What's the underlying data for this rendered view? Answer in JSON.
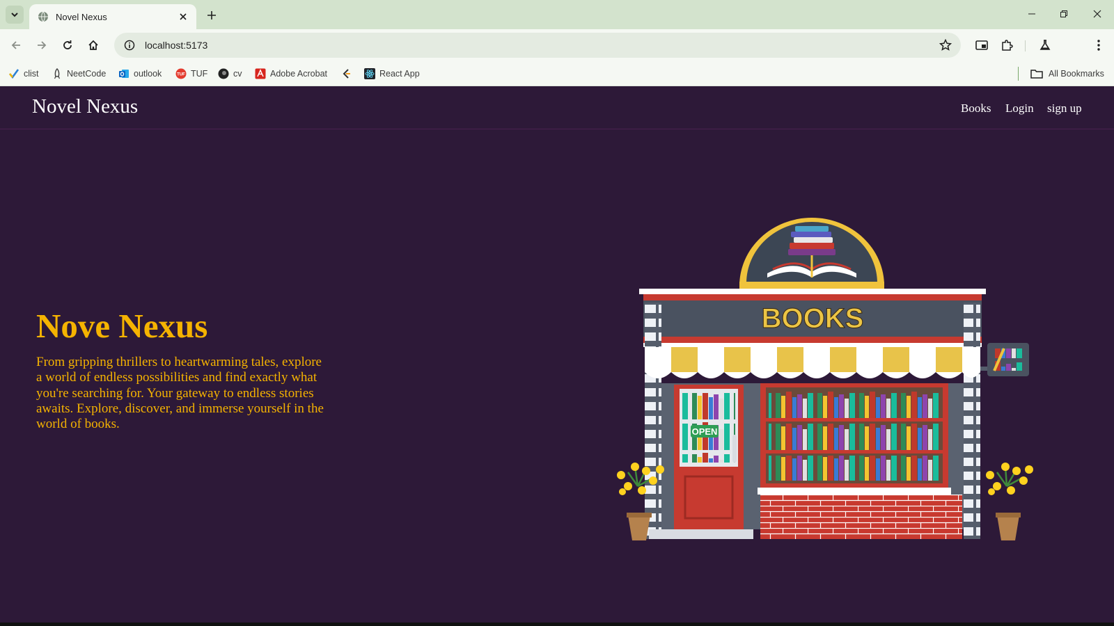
{
  "browser": {
    "tab_title": "Novel Nexus",
    "url": "localhost:5173",
    "bookmarks": [
      {
        "label": "clist",
        "icon": "clist-icon"
      },
      {
        "label": "NeetCode",
        "icon": "neetcode-icon"
      },
      {
        "label": "outlook",
        "icon": "outlook-icon"
      },
      {
        "label": "TUF",
        "icon": "tuf-icon"
      },
      {
        "label": "cv",
        "icon": "cv-icon"
      },
      {
        "label": "Adobe Acrobat",
        "icon": "acrobat-icon"
      },
      {
        "label": "",
        "icon": "leetcode-icon"
      },
      {
        "label": "React App",
        "icon": "react-icon"
      }
    ],
    "all_bookmarks": "All Bookmarks"
  },
  "site": {
    "logo": "Novel Nexus",
    "nav": [
      "Books",
      "Login",
      "sign up"
    ]
  },
  "hero": {
    "title": "Nove Nexus",
    "description": "From gripping thrillers to heartwarming tales, explore a world of endless possibilities and find exactly what you're searching for. Your gateway to endless stories awaits. Explore, discover, and immerse yourself in the world of books.",
    "illustration": {
      "sign_text": "BOOKS",
      "door_sign": "OPEN"
    }
  },
  "colors": {
    "page_bg": "#2d1938",
    "accent": "#f5b301",
    "chrome_tabstrip": "#d3e3cd",
    "chrome_toolbar": "#f5f8f3"
  }
}
